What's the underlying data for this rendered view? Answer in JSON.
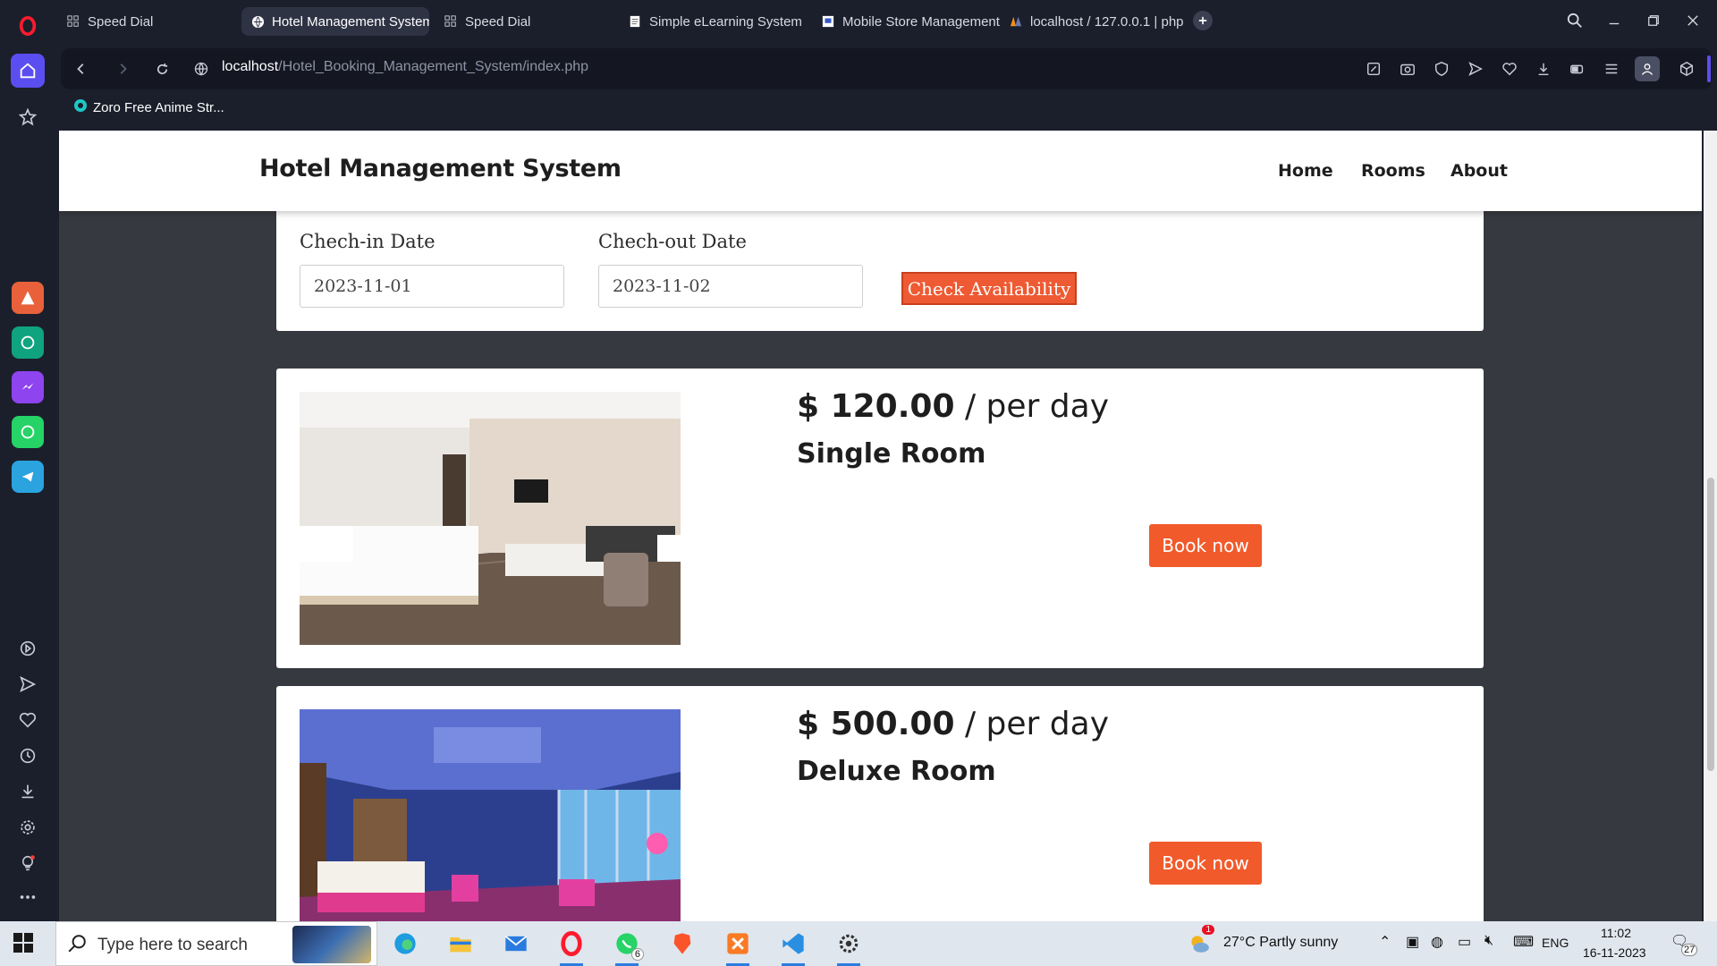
{
  "browser": {
    "tabs": [
      {
        "label": "Speed Dial",
        "icon": "grid-icon"
      },
      {
        "label": "Hotel Management System",
        "icon": "globe-icon"
      },
      {
        "label": "Speed Dial",
        "icon": "grid-icon"
      },
      {
        "label": "Simple eLearning System",
        "icon": "page-icon"
      },
      {
        "label": "Mobile Store Management",
        "icon": "page-icon"
      },
      {
        "label": "localhost / 127.0.0.1 | php",
        "icon": "phpmyadmin-icon"
      }
    ],
    "url_host": "localhost",
    "url_path": "/Hotel_Booking_Management_System/index.php",
    "bookmark": "Zoro Free Anime Str..."
  },
  "site": {
    "brand": "Hotel Management System",
    "nav": [
      "Home",
      "Rooms",
      "About"
    ]
  },
  "search": {
    "checkin_label": "Chech-in Date",
    "checkin_value": "2023-11-01",
    "checkout_label": "Chech-out Date",
    "checkout_value": "2023-11-02",
    "button": "Check Availability"
  },
  "rooms": [
    {
      "price": "$ 120.00",
      "unit": " / per day",
      "name": "Single Room",
      "button": "Book now"
    },
    {
      "price": "$ 500.00",
      "unit": " / per day",
      "name": "Deluxe Room",
      "button": "Book now"
    }
  ],
  "taskbar": {
    "search_placeholder": "Type here to search",
    "whatsapp_badge": "6",
    "weather_badge": "1",
    "weather": "27°C  Partly sunny",
    "lang": "ENG",
    "time": "11:02",
    "date": "16-11-2023",
    "notif_count": "27"
  },
  "colors": {
    "accent": "#f15a2b",
    "page_bg": "#363a40",
    "browser_bg": "#1b1f2c"
  }
}
